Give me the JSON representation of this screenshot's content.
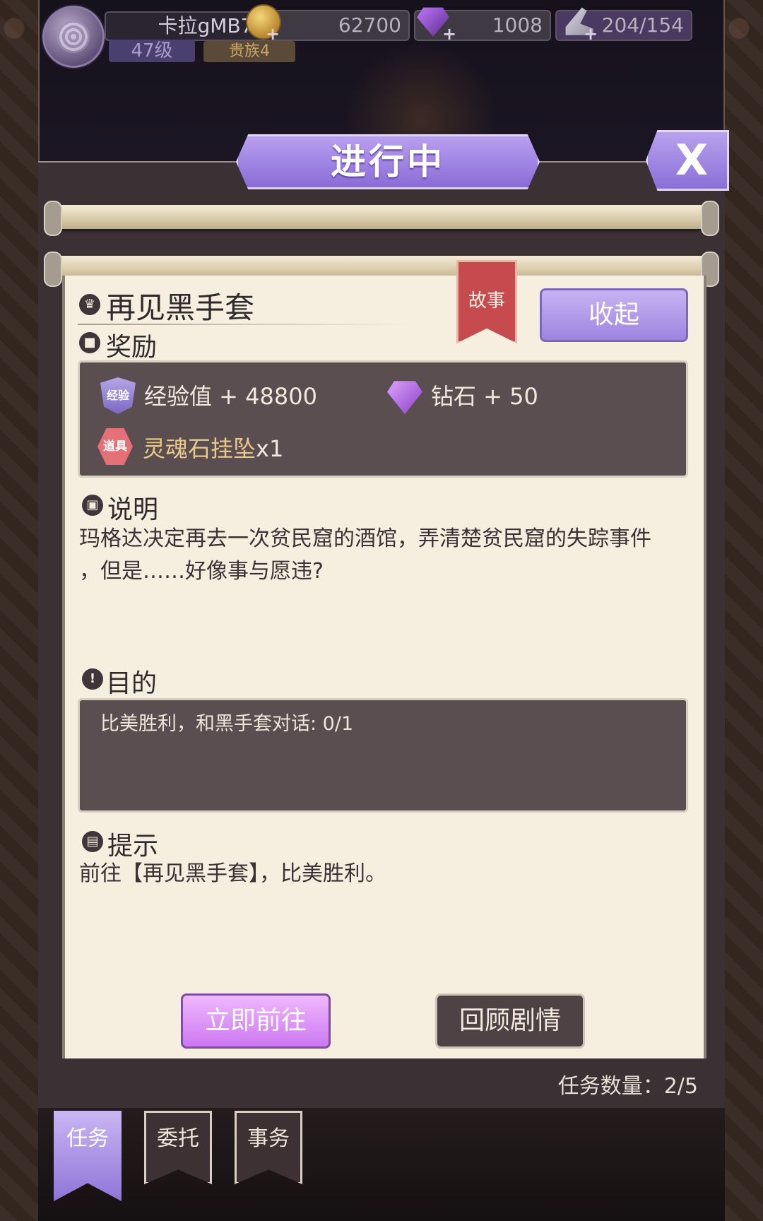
{
  "player": {
    "name": "卡拉gMB7",
    "level": "47级",
    "rank": "贵族4"
  },
  "resources": {
    "gold": "62700",
    "diamonds": "1008",
    "stamina": "204/154"
  },
  "dialog": {
    "title": "进行中",
    "close_label": "X"
  },
  "quest": {
    "name": "再见黑手套",
    "tag": "故事",
    "collapse_label": "收起",
    "reward_heading": "奖励",
    "rewards": [
      {
        "icon_label": "经验",
        "text": "经验值 + 48800",
        "icon": "exp-icon"
      },
      {
        "icon_label": "",
        "text": "钻石 + 50",
        "icon": "diamond-icon"
      },
      {
        "icon_label": "道具",
        "text": "灵魂石挂坠",
        "qty": "x1",
        "icon": "item-icon"
      }
    ],
    "description_heading": "说明",
    "description_line1": "玛格达决定再去一次贫民窟的酒馆，弄清楚贫民窟的失踪事件",
    "description_line2": "，但是……好像事与愿违?",
    "objective_heading": "目的",
    "objective_text": "比美胜利，和黑手套对话: 0/1",
    "hint_heading": "提示",
    "hint_text": "前往【再见黑手套】，比美胜利。",
    "go_label": "立即前往",
    "review_label": "回顾剧情",
    "count_text": "任务数量：2/5"
  },
  "tabs": [
    {
      "label": "任务",
      "active": true
    },
    {
      "label": "委托",
      "active": false
    },
    {
      "label": "事务",
      "active": false
    }
  ],
  "colors": {
    "accent_purple": "#9d85e0",
    "paper": "#f6efe0",
    "dark_box": "#5b4e50",
    "tag_red": "#c74a4e",
    "item_gold": "#e8c98a"
  }
}
